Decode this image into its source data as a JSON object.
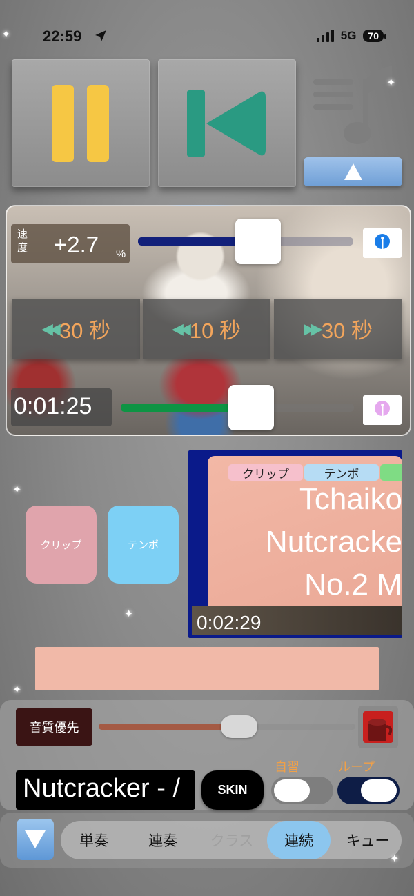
{
  "status_bar": {
    "time": "22:59",
    "network": "5G",
    "battery": "70"
  },
  "controls": {
    "pause": "pause",
    "previous": "previous"
  },
  "speed": {
    "label": "速度",
    "value": "+2.7",
    "unit": "%",
    "level": 0.6
  },
  "seek_buttons": [
    {
      "arrows": "◀◀",
      "label": "30 秒"
    },
    {
      "arrows": "◀◀",
      "label": "10 秒"
    },
    {
      "arrows": "▶▶",
      "label": "30 秒"
    }
  ],
  "position": {
    "time": "0:01:25",
    "level": 0.55
  },
  "quick_buttons": {
    "clip": "クリップ",
    "tempo": "テンポ"
  },
  "preview": {
    "tags": [
      "クリップ",
      "テンポ"
    ],
    "title_lines": [
      "Tchaiko",
      "Nutcracke",
      "No.2 M"
    ],
    "time": "0:02:29"
  },
  "quality": {
    "label": "音質優先",
    "level": 0.6
  },
  "now_playing": {
    "title": "Nutcracker - /"
  },
  "skin_button": "SKIN",
  "toggles": [
    {
      "label": "自習",
      "on": false
    },
    {
      "label": "ループ",
      "on": true
    }
  ],
  "nav": {
    "items": [
      "単奏",
      "連奏",
      "クラス",
      "連続",
      "キュー"
    ],
    "active": "連続"
  },
  "colors": {
    "accent_orange": "#f2a55c",
    "pause_yellow": "#f6c744",
    "play_teal": "#2a9a82",
    "active_blue": "#8cc6ee"
  }
}
